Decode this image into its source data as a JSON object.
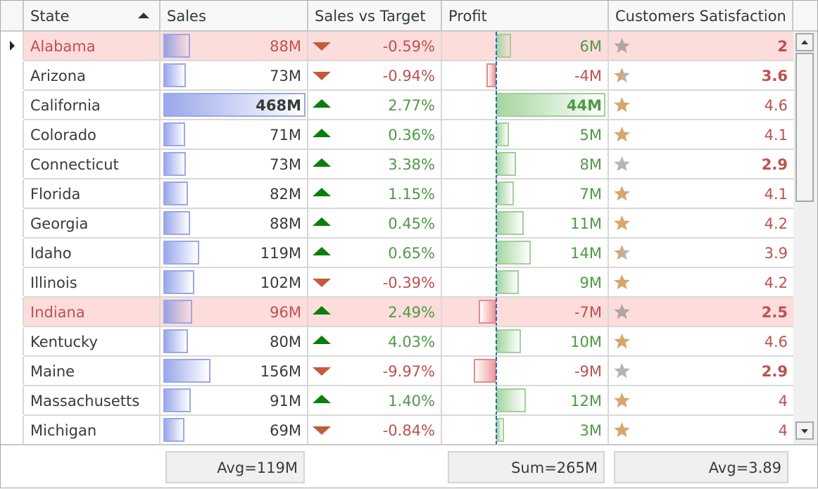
{
  "columns": {
    "state": "State",
    "sales": "Sales",
    "sales_vs_target": "Sales vs Target",
    "profit": "Profit",
    "satisfaction": "Customers Satisfaction"
  },
  "sort": {
    "column": "State",
    "direction": "ascending"
  },
  "colors": {
    "highlight_row": "#fddcdc",
    "positive": "#4e9a45",
    "negative": "#c0504d",
    "arrow_up": "#0a7d0a",
    "arrow_down": "#c55a3e",
    "sales_bar": "#9aa8ea",
    "star_gold": "#d9a56e",
    "star_gray": "#b4b4b4"
  },
  "rows": [
    {
      "state": "Alabama",
      "sales": "88M",
      "sales_num": 88,
      "svt": "-0.59%",
      "svt_dir": "down",
      "profit": "6M",
      "profit_num": 6,
      "sat": "2",
      "sat_num": 2,
      "sat_bold": true,
      "highlight": true,
      "current": true
    },
    {
      "state": "Arizona",
      "sales": "73M",
      "sales_num": 73,
      "svt": "-0.94%",
      "svt_dir": "down",
      "profit": "-4M",
      "profit_num": -4,
      "sat": "3.6",
      "sat_num": 3.6,
      "sat_bold": true,
      "highlight": false
    },
    {
      "state": "California",
      "sales": "468M",
      "sales_num": 468,
      "sales_bold": true,
      "svt": "2.77%",
      "svt_dir": "up",
      "profit": "44M",
      "profit_num": 44,
      "profit_bold": true,
      "sat": "4.6",
      "sat_num": 4.6,
      "highlight": false
    },
    {
      "state": "Colorado",
      "sales": "71M",
      "sales_num": 71,
      "svt": "0.36%",
      "svt_dir": "up",
      "profit": "5M",
      "profit_num": 5,
      "sat": "4.1",
      "sat_num": 4.1,
      "highlight": false
    },
    {
      "state": "Connecticut",
      "sales": "73M",
      "sales_num": 73,
      "svt": "3.38%",
      "svt_dir": "up",
      "profit": "8M",
      "profit_num": 8,
      "sat": "2.9",
      "sat_num": 2.9,
      "sat_bold": true,
      "highlight": false
    },
    {
      "state": "Florida",
      "sales": "82M",
      "sales_num": 82,
      "svt": "1.15%",
      "svt_dir": "up",
      "profit": "7M",
      "profit_num": 7,
      "sat": "4.1",
      "sat_num": 4.1,
      "highlight": false
    },
    {
      "state": "Georgia",
      "sales": "88M",
      "sales_num": 88,
      "svt": "0.45%",
      "svt_dir": "up",
      "profit": "11M",
      "profit_num": 11,
      "sat": "4.2",
      "sat_num": 4.2,
      "highlight": false
    },
    {
      "state": "Idaho",
      "sales": "119M",
      "sales_num": 119,
      "svt": "0.65%",
      "svt_dir": "up",
      "profit": "14M",
      "profit_num": 14,
      "sat": "3.9",
      "sat_num": 3.9,
      "highlight": false
    },
    {
      "state": "Illinois",
      "sales": "102M",
      "sales_num": 102,
      "svt": "-0.39%",
      "svt_dir": "down",
      "profit": "9M",
      "profit_num": 9,
      "sat": "4.2",
      "sat_num": 4.2,
      "highlight": false
    },
    {
      "state": "Indiana",
      "sales": "96M",
      "sales_num": 96,
      "svt": "2.49%",
      "svt_dir": "up",
      "profit": "-7M",
      "profit_num": -7,
      "sat": "2.5",
      "sat_num": 2.5,
      "sat_bold": true,
      "highlight": true
    },
    {
      "state": "Kentucky",
      "sales": "80M",
      "sales_num": 80,
      "svt": "4.03%",
      "svt_dir": "up",
      "profit": "10M",
      "profit_num": 10,
      "sat": "4.6",
      "sat_num": 4.6,
      "highlight": false
    },
    {
      "state": "Maine",
      "sales": "156M",
      "sales_num": 156,
      "svt": "-9.97%",
      "svt_dir": "down",
      "profit": "-9M",
      "profit_num": -9,
      "sat": "2.9",
      "sat_num": 2.9,
      "sat_bold": true,
      "highlight": false
    },
    {
      "state": "Massachusetts",
      "sales": "91M",
      "sales_num": 91,
      "svt": "1.40%",
      "svt_dir": "up",
      "profit": "12M",
      "profit_num": 12,
      "sat": "4",
      "sat_num": 4,
      "highlight": false
    },
    {
      "state": "Michigan",
      "sales": "69M",
      "sales_num": 69,
      "svt": "-0.84%",
      "svt_dir": "down",
      "profit": "3M",
      "profit_num": 3,
      "sat": "4",
      "sat_num": 4,
      "highlight": false
    }
  ],
  "bar_scales": {
    "sales_max": 468,
    "profit_max": 44
  },
  "footer": {
    "sales_summary": "Avg=119M",
    "profit_summary": "Sum=265M",
    "satisfaction_summary": "Avg=3.89"
  },
  "scrollbar": {
    "position_fraction": 0.0,
    "visible_fraction": 0.4
  }
}
